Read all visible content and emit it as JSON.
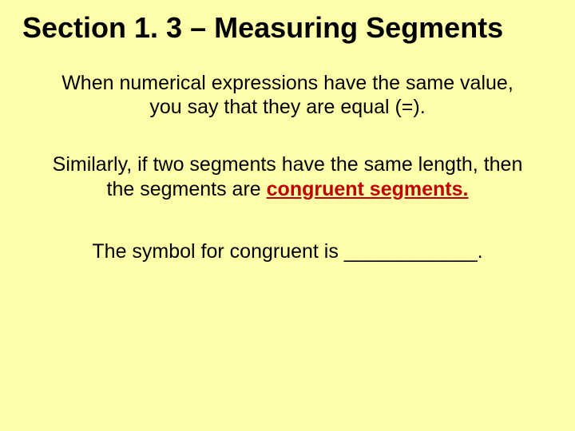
{
  "title": "Section 1. 3 – Measuring Segments",
  "p1_a": "When numerical expressions have the same value,",
  "p1_b": "you say that they are equal (=).",
  "p2_a": "Similarly, if two segments have the same length, then",
  "p2_b": "the segments are ",
  "p2_emph": "congruent segments.",
  "p3": "The symbol for congruent is ____________."
}
